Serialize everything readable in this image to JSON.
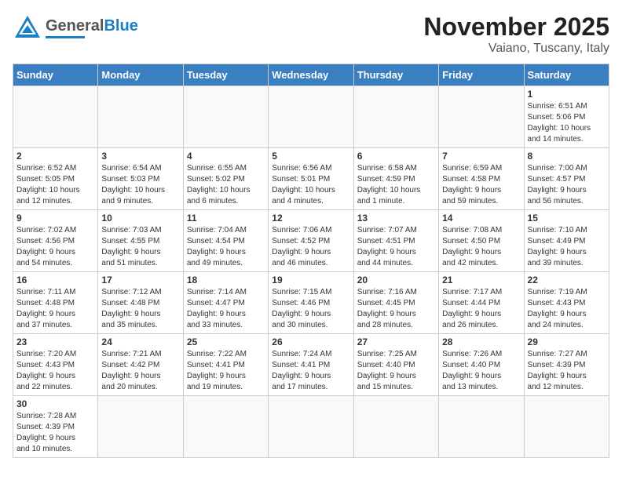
{
  "header": {
    "logo_general": "General",
    "logo_blue": "Blue",
    "month": "November 2025",
    "location": "Vaiano, Tuscany, Italy"
  },
  "weekdays": [
    "Sunday",
    "Monday",
    "Tuesday",
    "Wednesday",
    "Thursday",
    "Friday",
    "Saturday"
  ],
  "weeks": [
    [
      {
        "day": "",
        "info": ""
      },
      {
        "day": "",
        "info": ""
      },
      {
        "day": "",
        "info": ""
      },
      {
        "day": "",
        "info": ""
      },
      {
        "day": "",
        "info": ""
      },
      {
        "day": "",
        "info": ""
      },
      {
        "day": "1",
        "info": "Sunrise: 6:51 AM\nSunset: 5:06 PM\nDaylight: 10 hours\nand 14 minutes."
      }
    ],
    [
      {
        "day": "2",
        "info": "Sunrise: 6:52 AM\nSunset: 5:05 PM\nDaylight: 10 hours\nand 12 minutes."
      },
      {
        "day": "3",
        "info": "Sunrise: 6:54 AM\nSunset: 5:03 PM\nDaylight: 10 hours\nand 9 minutes."
      },
      {
        "day": "4",
        "info": "Sunrise: 6:55 AM\nSunset: 5:02 PM\nDaylight: 10 hours\nand 6 minutes."
      },
      {
        "day": "5",
        "info": "Sunrise: 6:56 AM\nSunset: 5:01 PM\nDaylight: 10 hours\nand 4 minutes."
      },
      {
        "day": "6",
        "info": "Sunrise: 6:58 AM\nSunset: 4:59 PM\nDaylight: 10 hours\nand 1 minute."
      },
      {
        "day": "7",
        "info": "Sunrise: 6:59 AM\nSunset: 4:58 PM\nDaylight: 9 hours\nand 59 minutes."
      },
      {
        "day": "8",
        "info": "Sunrise: 7:00 AM\nSunset: 4:57 PM\nDaylight: 9 hours\nand 56 minutes."
      }
    ],
    [
      {
        "day": "9",
        "info": "Sunrise: 7:02 AM\nSunset: 4:56 PM\nDaylight: 9 hours\nand 54 minutes."
      },
      {
        "day": "10",
        "info": "Sunrise: 7:03 AM\nSunset: 4:55 PM\nDaylight: 9 hours\nand 51 minutes."
      },
      {
        "day": "11",
        "info": "Sunrise: 7:04 AM\nSunset: 4:54 PM\nDaylight: 9 hours\nand 49 minutes."
      },
      {
        "day": "12",
        "info": "Sunrise: 7:06 AM\nSunset: 4:52 PM\nDaylight: 9 hours\nand 46 minutes."
      },
      {
        "day": "13",
        "info": "Sunrise: 7:07 AM\nSunset: 4:51 PM\nDaylight: 9 hours\nand 44 minutes."
      },
      {
        "day": "14",
        "info": "Sunrise: 7:08 AM\nSunset: 4:50 PM\nDaylight: 9 hours\nand 42 minutes."
      },
      {
        "day": "15",
        "info": "Sunrise: 7:10 AM\nSunset: 4:49 PM\nDaylight: 9 hours\nand 39 minutes."
      }
    ],
    [
      {
        "day": "16",
        "info": "Sunrise: 7:11 AM\nSunset: 4:48 PM\nDaylight: 9 hours\nand 37 minutes."
      },
      {
        "day": "17",
        "info": "Sunrise: 7:12 AM\nSunset: 4:48 PM\nDaylight: 9 hours\nand 35 minutes."
      },
      {
        "day": "18",
        "info": "Sunrise: 7:14 AM\nSunset: 4:47 PM\nDaylight: 9 hours\nand 33 minutes."
      },
      {
        "day": "19",
        "info": "Sunrise: 7:15 AM\nSunset: 4:46 PM\nDaylight: 9 hours\nand 30 minutes."
      },
      {
        "day": "20",
        "info": "Sunrise: 7:16 AM\nSunset: 4:45 PM\nDaylight: 9 hours\nand 28 minutes."
      },
      {
        "day": "21",
        "info": "Sunrise: 7:17 AM\nSunset: 4:44 PM\nDaylight: 9 hours\nand 26 minutes."
      },
      {
        "day": "22",
        "info": "Sunrise: 7:19 AM\nSunset: 4:43 PM\nDaylight: 9 hours\nand 24 minutes."
      }
    ],
    [
      {
        "day": "23",
        "info": "Sunrise: 7:20 AM\nSunset: 4:43 PM\nDaylight: 9 hours\nand 22 minutes."
      },
      {
        "day": "24",
        "info": "Sunrise: 7:21 AM\nSunset: 4:42 PM\nDaylight: 9 hours\nand 20 minutes."
      },
      {
        "day": "25",
        "info": "Sunrise: 7:22 AM\nSunset: 4:41 PM\nDaylight: 9 hours\nand 19 minutes."
      },
      {
        "day": "26",
        "info": "Sunrise: 7:24 AM\nSunset: 4:41 PM\nDaylight: 9 hours\nand 17 minutes."
      },
      {
        "day": "27",
        "info": "Sunrise: 7:25 AM\nSunset: 4:40 PM\nDaylight: 9 hours\nand 15 minutes."
      },
      {
        "day": "28",
        "info": "Sunrise: 7:26 AM\nSunset: 4:40 PM\nDaylight: 9 hours\nand 13 minutes."
      },
      {
        "day": "29",
        "info": "Sunrise: 7:27 AM\nSunset: 4:39 PM\nDaylight: 9 hours\nand 12 minutes."
      }
    ],
    [
      {
        "day": "30",
        "info": "Sunrise: 7:28 AM\nSunset: 4:39 PM\nDaylight: 9 hours\nand 10 minutes."
      },
      {
        "day": "",
        "info": ""
      },
      {
        "day": "",
        "info": ""
      },
      {
        "day": "",
        "info": ""
      },
      {
        "day": "",
        "info": ""
      },
      {
        "day": "",
        "info": ""
      },
      {
        "day": "",
        "info": ""
      }
    ]
  ]
}
